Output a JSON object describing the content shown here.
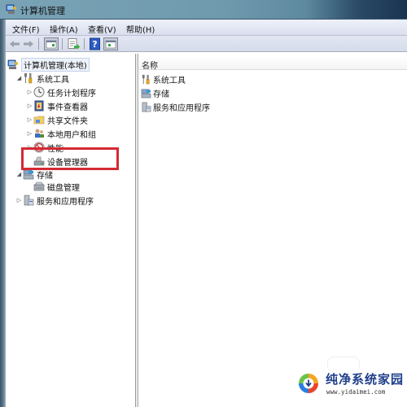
{
  "window": {
    "title": "计算机管理"
  },
  "menubar": {
    "items": [
      {
        "label": "文件(F)"
      },
      {
        "label": "操作(A)"
      },
      {
        "label": "查看(V)"
      },
      {
        "label": "帮助(H)"
      }
    ]
  },
  "toolbar": {
    "buttons": [
      {
        "icon": "back-arrow-icon"
      },
      {
        "icon": "forward-arrow-icon"
      },
      {
        "icon": "show-hide-console-tree-icon"
      },
      {
        "icon": "export-list-icon"
      },
      {
        "icon": "help-icon"
      },
      {
        "icon": "show-hide-action-pane-icon"
      }
    ]
  },
  "tree": {
    "root": {
      "label": "计算机管理(本地)",
      "icon": "computer-management-icon",
      "selected": true
    },
    "items": [
      {
        "label": "系统工具",
        "icon": "tools-icon",
        "expander": "expanded",
        "level": 1
      },
      {
        "label": "任务计划程序",
        "icon": "clock-icon",
        "expander": "collapsed",
        "level": 2
      },
      {
        "label": "事件查看器",
        "icon": "event-viewer-icon",
        "expander": "collapsed",
        "level": 2
      },
      {
        "label": "共享文件夹",
        "icon": "shared-folder-icon",
        "expander": "collapsed",
        "level": 2
      },
      {
        "label": "本地用户和组",
        "icon": "users-icon",
        "expander": "collapsed",
        "level": 2
      },
      {
        "label": "性能",
        "icon": "performance-icon",
        "expander": "collapsed",
        "level": 2
      },
      {
        "label": "设备管理器",
        "icon": "device-manager-icon",
        "expander": "none",
        "level": 2,
        "highlighted": true
      },
      {
        "label": "存储",
        "icon": "storage-icon",
        "expander": "expanded",
        "level": 1
      },
      {
        "label": "磁盘管理",
        "icon": "disk-management-icon",
        "expander": "none",
        "level": 2
      },
      {
        "label": "服务和应用程序",
        "icon": "services-icon",
        "expander": "collapsed",
        "level": 1
      }
    ]
  },
  "list": {
    "column_header": "名称",
    "rows": [
      {
        "label": "系统工具",
        "icon": "tools-icon"
      },
      {
        "label": "存储",
        "icon": "storage-icon"
      },
      {
        "label": "服务和应用程序",
        "icon": "services-icon"
      }
    ]
  },
  "watermark": {
    "name": "纯净系统家园",
    "url": "www.yidaimei.com"
  },
  "colors": {
    "highlight_box": "#d42a32",
    "watermark_text": "#1f3f8a"
  }
}
